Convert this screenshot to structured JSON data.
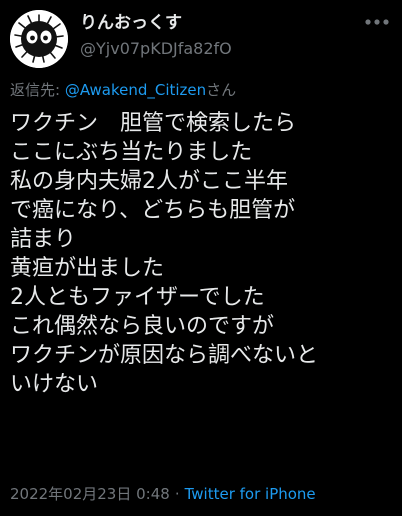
{
  "user": {
    "display_name": "りんおっくす",
    "handle": "@Yjv07pKDJfa82fO"
  },
  "reply": {
    "prefix": "返信先: ",
    "mention": "@Awakend_Citizen",
    "suffix": "さん"
  },
  "tweet": {
    "lines": [
      "ワクチン　胆管で検索したら",
      "ここにぶち当たりました",
      "私の身内夫婦2人がここ半年",
      "で癌になり、どちらも胆管が",
      "詰まり",
      "黄疸が出ました",
      "2人ともファイザーでした",
      "これ偶然なら良いのですが",
      "ワクチンが原因なら調べないと",
      "いけない"
    ]
  },
  "meta": {
    "datetime": "2022年02月23日 0:48",
    "separator": "·",
    "source": "Twitter for iPhone"
  },
  "icons": {
    "avatar": "soot-sprite-avatar",
    "more": "more-options-icon"
  },
  "colors": {
    "background": "#000000",
    "text": "#e7e9ea",
    "secondary": "#71767b",
    "accent": "#1d9bf0"
  }
}
